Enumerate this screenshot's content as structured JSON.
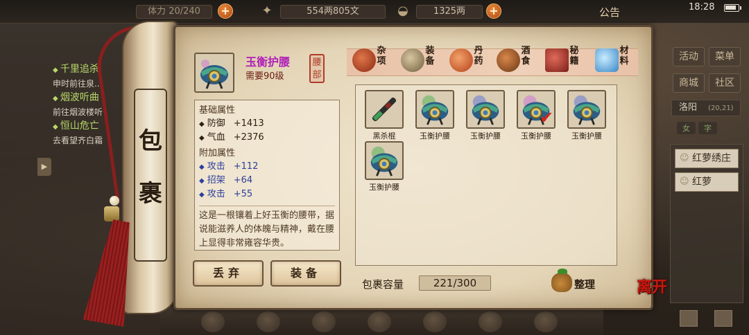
{
  "topbar": {
    "bag_label": "体力",
    "bag_value": "20/240",
    "silver": "554两805文",
    "gold": "1325两",
    "notice": "公告",
    "time": "18:28"
  },
  "quests": [
    {
      "title": "千里追杀",
      "sub": "申时前往泉..."
    },
    {
      "title": "烟波听曲",
      "sub": "前往烟波楼听"
    },
    {
      "title": "恒山危亡",
      "sub": "去看望齐白霜"
    }
  ],
  "side_menu": {
    "activity": "活动",
    "menu": "菜单",
    "shop": "商城",
    "community": "社区",
    "location": "洛阳",
    "coords": "(20,21)",
    "tab_a": "女",
    "tab_b": "字",
    "npcs": [
      "红萝绣庄",
      "红萝"
    ]
  },
  "scroll_title": [
    "包",
    "裹"
  ],
  "item": {
    "name": "玉衡护腰",
    "requirement": "需要90级",
    "slot": "腰部",
    "base_header": "基础属性",
    "base_attrs": [
      {
        "name": "防御",
        "value": "+1413"
      },
      {
        "name": "气血",
        "value": "+2376"
      }
    ],
    "bonus_header": "附加属性",
    "bonus_attrs": [
      {
        "name": "攻击",
        "value": "+112"
      },
      {
        "name": "招架",
        "value": "+64"
      },
      {
        "name": "攻击",
        "value": "+55"
      }
    ],
    "description": "这是一根镶着上好玉衡的腰带，据说能滋养人的体魄与精神，戴在腰上显得非常雍容华贵。"
  },
  "buttons": {
    "discard": "丢弃",
    "equip": "装备",
    "sort": "整理",
    "leave": "离开"
  },
  "categories": [
    {
      "label": "杂项",
      "color": "#b8452a"
    },
    {
      "label": "装备",
      "color": "#8a7a52"
    },
    {
      "label": "丹药",
      "color": "#d2501e"
    },
    {
      "label": "酒食",
      "color": "#9a5a2a"
    },
    {
      "label": "秘籍",
      "color": "#a8322a"
    },
    {
      "label": "材料",
      "color": "#6fb6e0"
    }
  ],
  "inventory": [
    {
      "name": "黑杀棍",
      "icon": "staff-icon"
    },
    {
      "name": "玉衡护腰",
      "icon": "belt-icon"
    },
    {
      "name": "玉衡护腰",
      "icon": "belt-icon"
    },
    {
      "name": "玉衡护腰",
      "icon": "belt-icon",
      "selected": true
    },
    {
      "name": "玉衡护腰",
      "icon": "belt-icon"
    },
    {
      "name": "玉衡护腰",
      "icon": "belt-icon"
    }
  ],
  "capacity": {
    "label": "包裹容量",
    "value": "221/300"
  }
}
